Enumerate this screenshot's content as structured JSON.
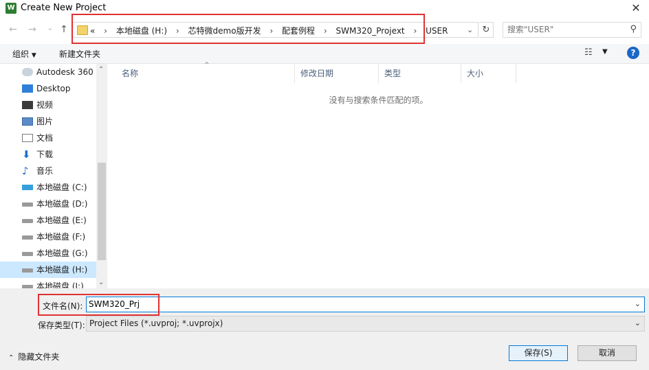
{
  "window": {
    "title": "Create New Project",
    "app_icon_letter": "W"
  },
  "nav": {
    "back_label": "←",
    "forward_label": "→",
    "recent_label": "⌄",
    "up_label": "↑",
    "breadcrumb_overflow": "«",
    "breadcrumbs": [
      "本地磁盘 (H:)",
      "芯特微demo版开发",
      "配套例程",
      "SWM320_Projext",
      "USER"
    ],
    "search_placeholder": "搜索\"USER\""
  },
  "toolbar": {
    "organize_label": "组织",
    "new_folder_label": "新建文件夹"
  },
  "sidebar": {
    "items": [
      {
        "label": "Autodesk 360",
        "icon": "cloud-icon"
      },
      {
        "label": "Desktop",
        "icon": "desktop-icon"
      },
      {
        "label": "视频",
        "icon": "video-icon"
      },
      {
        "label": "图片",
        "icon": "picture-icon"
      },
      {
        "label": "文档",
        "icon": "document-icon"
      },
      {
        "label": "下载",
        "icon": "download-icon"
      },
      {
        "label": "音乐",
        "icon": "music-icon"
      },
      {
        "label": "本地磁盘 (C:)",
        "icon": "drive-icon"
      },
      {
        "label": "本地磁盘 (D:)",
        "icon": "drive-icon"
      },
      {
        "label": "本地磁盘 (E:)",
        "icon": "drive-icon"
      },
      {
        "label": "本地磁盘 (F:)",
        "icon": "drive-icon"
      },
      {
        "label": "本地磁盘 (G:)",
        "icon": "drive-icon"
      },
      {
        "label": "本地磁盘 (H:)",
        "icon": "drive-icon",
        "selected": true
      },
      {
        "label": "本地磁盘 (I:)",
        "icon": "drive-icon"
      }
    ]
  },
  "filelist": {
    "columns": [
      "名称",
      "修改日期",
      "类型",
      "大小"
    ],
    "empty_message": "没有与搜索条件匹配的项。"
  },
  "bottom": {
    "filename_label": "文件名(N):",
    "filename_value": "SWM320_Prj",
    "filetype_label": "保存类型(T):",
    "filetype_value": "Project Files (*.uvproj; *.uvprojx)",
    "hide_folders_label": "隐藏文件夹",
    "save_label": "保存(S)",
    "cancel_label": "取消"
  },
  "colors": {
    "highlight": "#e03030",
    "accent": "#0078d7"
  }
}
